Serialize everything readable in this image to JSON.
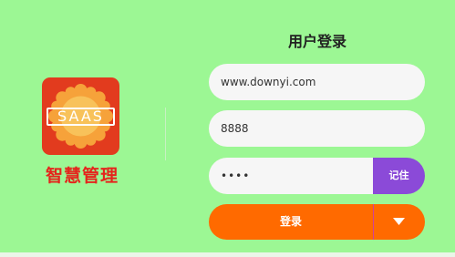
{
  "logo": {
    "icon": "saas-flower-logo",
    "text": "SAAS",
    "brand_name": "智慧管理"
  },
  "form": {
    "title": "用户登录",
    "username_value": "www.downyi.com",
    "company_value": "8888",
    "password_value": "••••",
    "remember_label": "记住",
    "login_label": "登录",
    "dropdown_icon": "caret-down-icon"
  },
  "colors": {
    "background": "#9cf794",
    "logo_red": "#e23b1e",
    "brand_red": "#e5241c",
    "remember_purple": "#8b4ad8",
    "login_orange": "#ff6a00"
  }
}
